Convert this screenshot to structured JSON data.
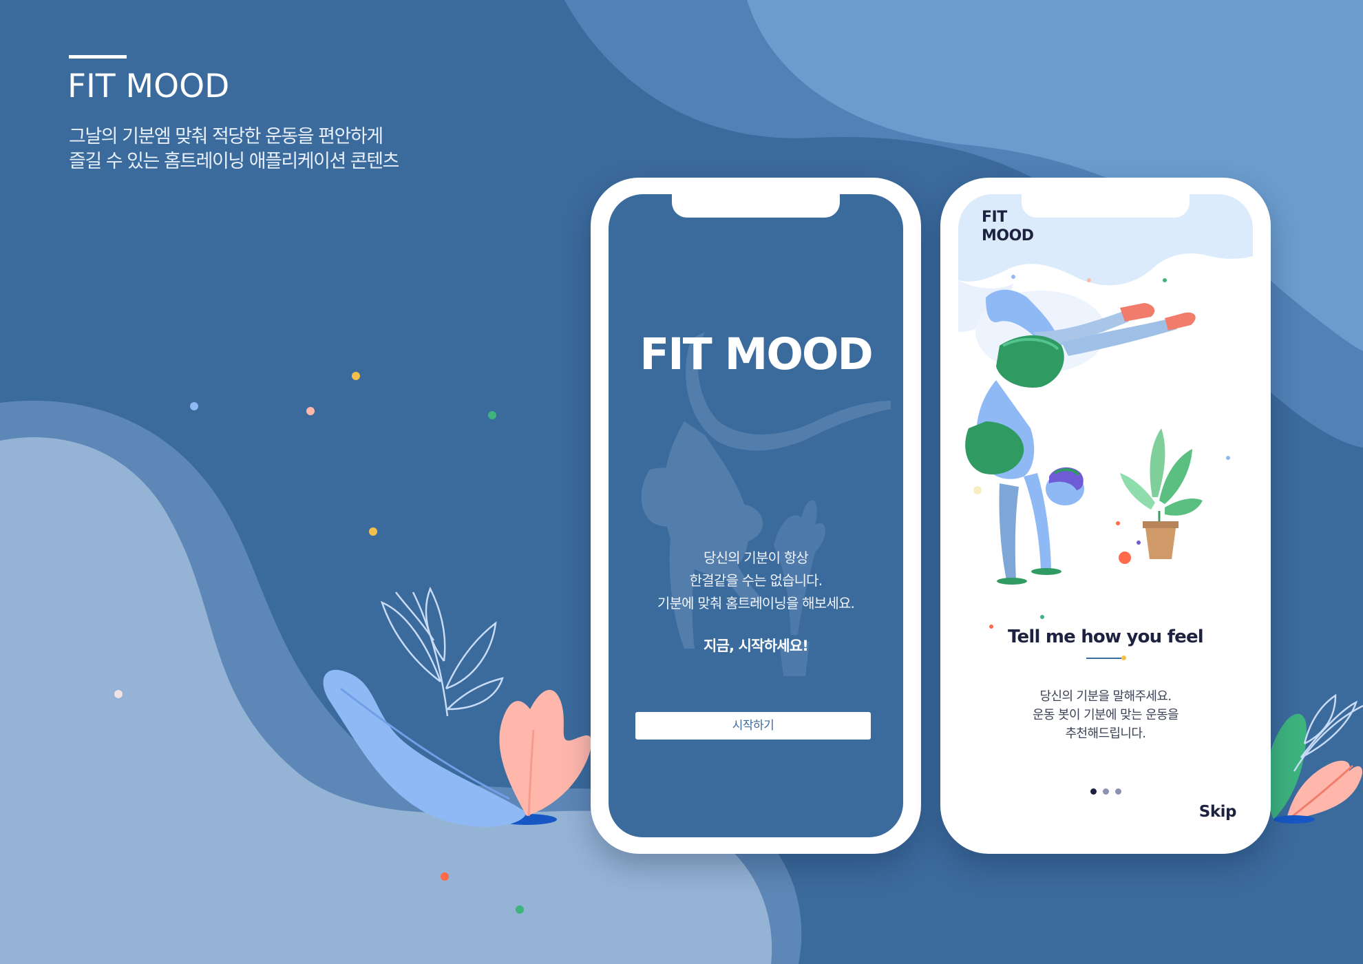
{
  "intro": {
    "title": "FIT MOOD",
    "description_lines": [
      "그날의 기분엠 맞춰 적당한 운동을 편안하게",
      "즐길 수 있는 홈트레이닝 애플리케이션 콘텐츠"
    ]
  },
  "splash_screen": {
    "app_title": "FIT MOOD",
    "message_lines": [
      "당신의 기분이 항상",
      "한결같을 수는 없습니다.",
      "기분에 맞춰 홈트레이닝을 해보세요."
    ],
    "call_to_action": "지금, 시작하세요!",
    "start_button_label": "시작하기"
  },
  "onboarding_screen": {
    "logo_lines": [
      "FIT",
      "MOOD"
    ],
    "headline": "Tell me how you feel",
    "message_lines": [
      "당신의 기분을 말해주세요.",
      "운동 봇이 기분에 맞는 운동을",
      "추천해드립니다."
    ],
    "page_indicator": {
      "total": 3,
      "current": 1
    },
    "skip_label": "Skip"
  },
  "colors": {
    "background_navy": "#3b6a9c",
    "background_light_blue": "#6b9ccd",
    "blob_pale": "#95b3d5",
    "text_dark": "#1d2240",
    "leaf_blue": "#8fb9f5",
    "leaf_pink": "#ffb7ac",
    "leaf_green": "#3db37e",
    "accent_orange": "#ff6b4a"
  },
  "icons": [
    "leaf-decoration",
    "plant-pot",
    "confetti-dot",
    "yoga-figure"
  ]
}
